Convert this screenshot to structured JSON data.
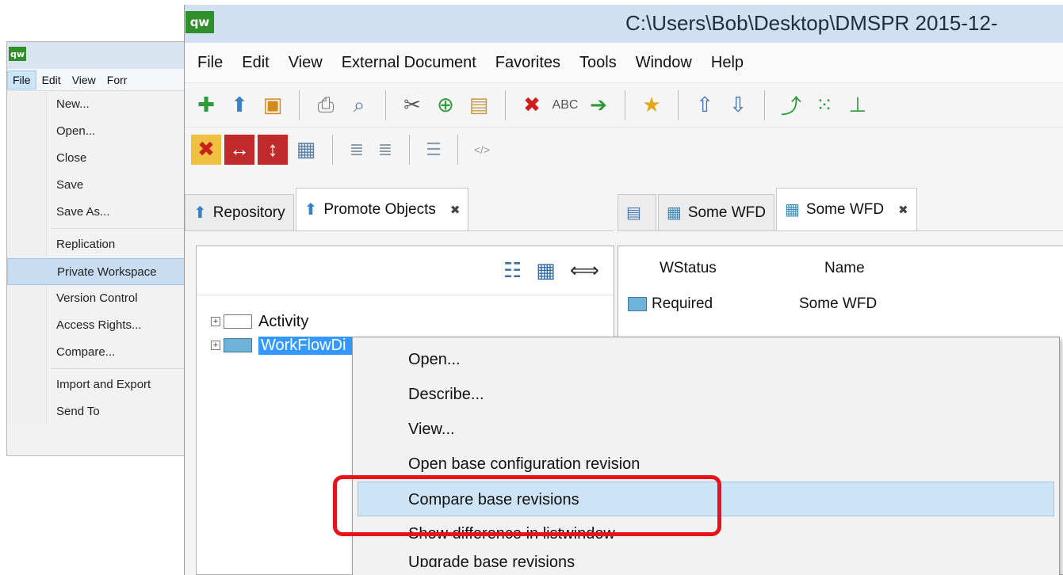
{
  "background_window": {
    "logo": "qw",
    "menubar": [
      "File",
      "Edit",
      "View",
      "Forr"
    ],
    "file_menu": [
      {
        "label": "New...",
        "highlight": false
      },
      {
        "label": "Open...",
        "highlight": false
      },
      {
        "label": "Close",
        "highlight": false
      },
      {
        "label": "Save",
        "highlight": false
      },
      {
        "label": "Save As...",
        "highlight": false
      },
      {
        "separator": true
      },
      {
        "label": "Replication",
        "highlight": false
      },
      {
        "label": "Private Workspace",
        "highlight": true
      },
      {
        "label": "Version Control",
        "highlight": false
      },
      {
        "label": "Access Rights...",
        "highlight": false
      },
      {
        "label": "Compare...",
        "highlight": false
      },
      {
        "separator": true
      },
      {
        "label": "Import and Export",
        "highlight": false
      },
      {
        "label": "Send To",
        "highlight": false
      }
    ]
  },
  "main_window": {
    "logo": "qw",
    "title": "C:\\Users\\Bob\\Desktop\\DMSPR 2015-12-",
    "menubar": [
      "File",
      "Edit",
      "View",
      "External Document",
      "Favorites",
      "Tools",
      "Window",
      "Help"
    ],
    "toolbar1": [
      "add-icon",
      "import-icon",
      "save-icon",
      "|",
      "print-icon",
      "search-icon",
      "|",
      "cut-icon",
      "new-icon",
      "paste-icon",
      "|",
      "delete-icon",
      "rename-icon",
      "move-icon",
      "|",
      "favorite-icon",
      "|",
      "upload-icon",
      "download-icon",
      "|",
      "link-icon",
      "tree-icon",
      "hierarchy-icon"
    ],
    "toolbar2": [
      "red-x-icon",
      "swap-horizontal-icon",
      "swap-vertical-icon",
      "grid-icon",
      "|",
      "list-add-icon",
      "list-check-icon",
      "|",
      "list-icon",
      "|",
      "html-icon"
    ],
    "left_tabs": [
      {
        "label": "Repository",
        "active": false,
        "closable": false
      },
      {
        "label": "Promote Objects",
        "active": true,
        "closable": true
      }
    ],
    "right_tabs": [
      {
        "label": "",
        "active": false,
        "closable": false
      },
      {
        "label": "Some WFD",
        "active": false,
        "closable": false
      },
      {
        "label": "Some WFD",
        "active": true,
        "closable": true
      }
    ],
    "tree": [
      {
        "label": "Activity",
        "selected": false
      },
      {
        "label": "WorkFlowDi",
        "selected": true
      }
    ],
    "list": {
      "headers": [
        "WStatus",
        "Name"
      ],
      "rows": [
        {
          "status": "Required",
          "name": "Some WFD"
        }
      ]
    },
    "context_menu": [
      {
        "label": "Open...",
        "hover": false
      },
      {
        "label": "Describe...",
        "hover": false
      },
      {
        "label": "View...",
        "hover": false
      },
      {
        "label": "Open base configuration revision",
        "hover": false
      },
      {
        "label": "Compare base revisions",
        "hover": true
      },
      {
        "label": "Show difference in listwindow",
        "hover": false
      },
      {
        "label": "Upgrade base revisions",
        "hover": false
      }
    ]
  },
  "colors": {
    "highlight_red": "#e8121b",
    "selection_blue": "#3399ff",
    "menu_hover": "#cde4f7",
    "logo_green": "#2f8f2a"
  }
}
